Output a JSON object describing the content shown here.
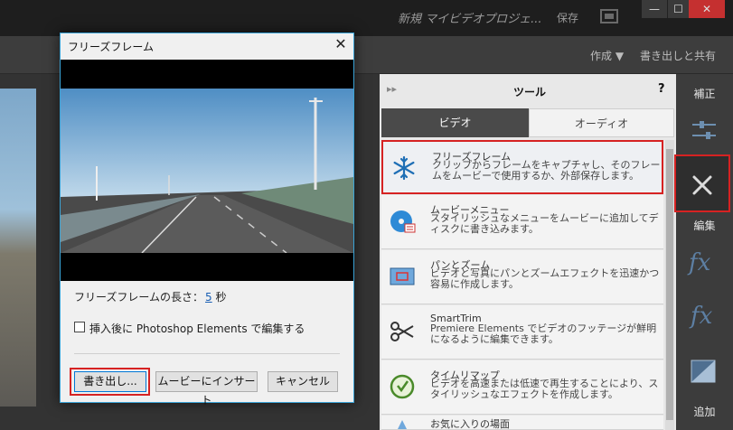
{
  "app": {
    "project_title": "新規 マイビデオプロジェ...",
    "save_label": "保存",
    "window_buttons": {
      "minimize": "—",
      "maximize": "☐",
      "close": "✕"
    }
  },
  "toolbar": {
    "create_label": "作成 ▼",
    "export_share_label": "書き出しと共有"
  },
  "tools_panel": {
    "collapse_arrows": "▸▸",
    "title": "ツール",
    "help": "?",
    "tabs": [
      {
        "label": "ビデオ",
        "active": true
      },
      {
        "label": "オーディオ",
        "active": false
      }
    ],
    "items": [
      {
        "name": "フリーズフレーム",
        "desc": "クリップからフレームをキャプチャし、そのフレームをムービーで使用するか、外部保存します。",
        "icon": "snowflake-icon"
      },
      {
        "name": "ムービーメニュー",
        "desc": "スタイリッシュなメニューをムービーに追加してディスクに書き込みます。",
        "icon": "disc-menu-icon"
      },
      {
        "name": "パンとズーム",
        "desc": "ビデオと写真にパンとズームエフェクトを迅速かつ容易に作成します。",
        "icon": "pan-zoom-icon"
      },
      {
        "name": "SmartTrim",
        "desc": "Premiere Elements でビデオのフッテージが鮮明になるように編集できます。",
        "icon": "scissors-icon"
      },
      {
        "name": "タイムリマップ",
        "desc": "ビデオを高速または低速で再生することにより、スタイリッシュなエフェクトを作成します。",
        "icon": "time-remap-icon"
      },
      {
        "name": "お気に入りの場面",
        "desc": "",
        "icon": "favorite-icon"
      }
    ]
  },
  "right_strip": {
    "adjust_label": "補正",
    "edit_label": "編集",
    "add_label": "追加"
  },
  "dialog": {
    "title": "フリーズフレーム",
    "close": "✕",
    "length_label": "フリーズフレームの長さ：",
    "length_value": "5",
    "length_unit": "秒",
    "checkbox_label": "挿入後に Photoshop Elements で編集する",
    "checkbox_checked": false,
    "buttons": {
      "export": "書き出し...",
      "insert": "ムービーにインサート",
      "cancel": "キャンセル"
    }
  },
  "colors": {
    "highlight": "#d62222",
    "accent": "#3aa3d6"
  }
}
